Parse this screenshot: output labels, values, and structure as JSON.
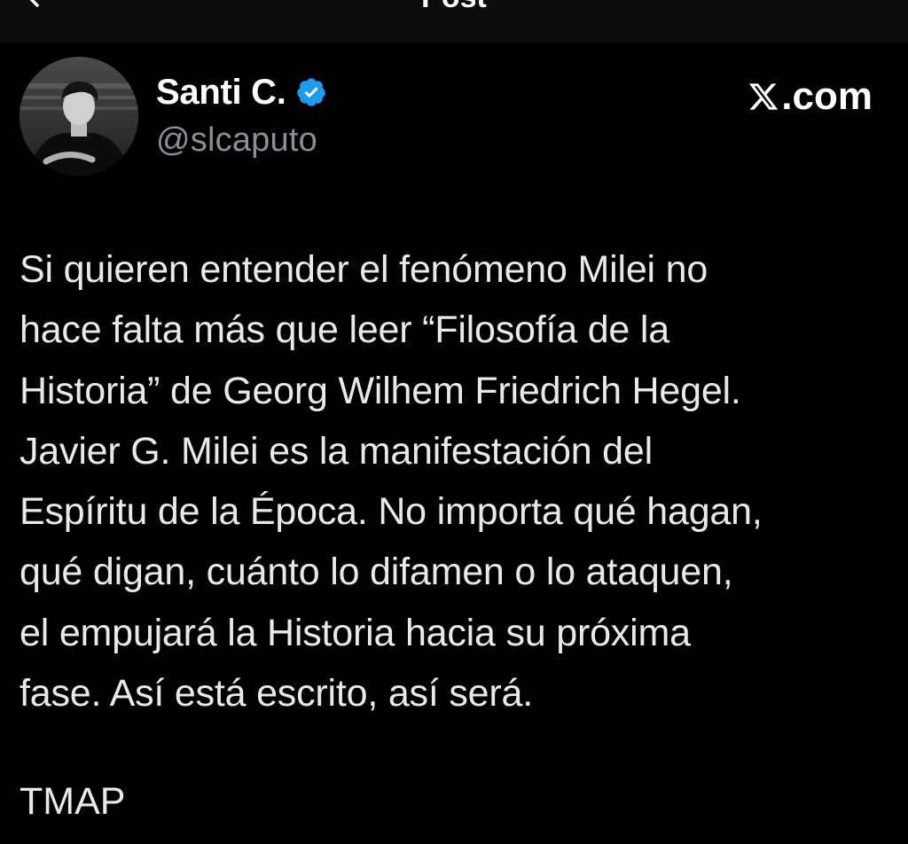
{
  "header": {
    "title": "Post",
    "back_icon": "arrow-left-icon"
  },
  "author": {
    "display_name": "Santi C.",
    "handle": "@slcaputo",
    "verified_icon": "verified-badge-icon",
    "verified_color": "#1d9bf0",
    "avatar": "avatar-photo"
  },
  "brand": {
    "logo_icon": "x-logo-icon",
    "label": ".com"
  },
  "post": {
    "text": "Si quieren entender el fenómeno Milei no\nhace falta más que leer “Filosofía de la\nHistoria” de Georg Wilhem Friedrich Hegel.\nJavier G. Milei es la manifestación del\nEspíritu de la Época. No importa qué hagan,\nqué digan, cuánto lo difamen o lo ataquen,\nel empujará la Historia hacia su próxima\nfase. Así está escrito, así será.",
    "tag": "TMAP"
  },
  "colors": {
    "background": "#000000",
    "text_primary": "#e7e9ea",
    "text_secondary": "#8b8f94",
    "accent": "#1d9bf0"
  }
}
